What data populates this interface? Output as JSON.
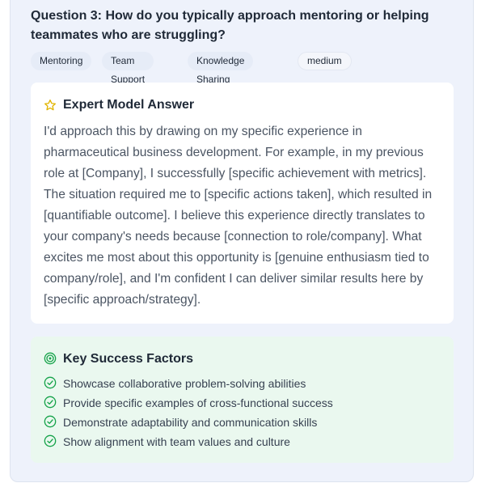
{
  "question": {
    "text": "Question 3: How do you typically approach mentoring or helping teammates who are struggling?"
  },
  "tags": [
    {
      "label": "Mentoring"
    },
    {
      "label": "Team Support"
    },
    {
      "label": "Knowledge Sharing"
    }
  ],
  "difficulty": {
    "label": "medium"
  },
  "answer": {
    "title": "Expert Model Answer",
    "icon": "star-icon",
    "body": "I'd approach this by drawing on my specific experience in pharmaceutical business development. For example, in my previous role at [Company], I successfully [specific achievement with metrics]. The situation required me to [specific actions taken], which resulted in [quantifiable outcome]. I believe this experience directly translates to your company's needs because [connection to role/company]. What excites me most about this opportunity is [genuine enthusiasm tied to company/role], and I'm confident I can deliver similar results here by [specific approach/strategy]."
  },
  "factors": {
    "title": "Key Success Factors",
    "icon": "target-icon",
    "item_icon": "check-circle-icon",
    "items": [
      "Showcase collaborative problem-solving abilities",
      "Provide specific examples of cross-functional success",
      "Demonstrate adaptability and communication skills",
      "Show alignment with team values and culture"
    ]
  },
  "colors": {
    "star": "#e0b400",
    "success": "#16a34a",
    "card_bg": "#eef2fb",
    "factors_bg": "#eaf8ef"
  }
}
